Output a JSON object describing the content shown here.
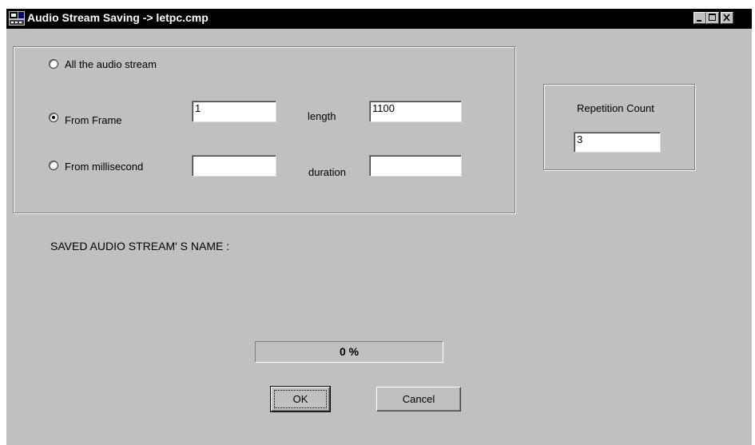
{
  "window": {
    "title": "Audio Stream Saving -> letpc.cmp",
    "controls": {
      "minimize_icon": "minimize-icon",
      "maximize_icon": "maximize-icon",
      "close_icon": "close-icon"
    }
  },
  "range_group": {
    "all_label": "All the audio stream",
    "all_checked": false,
    "frame_label": "From Frame",
    "frame_checked": true,
    "frame_value": "1",
    "length_label": "length",
    "length_value": "1100",
    "ms_label": "From millisecond",
    "ms_checked": false,
    "ms_value": "",
    "duration_label": "duration",
    "duration_value": ""
  },
  "repetition": {
    "label": "Repetition Count",
    "value": "3"
  },
  "saved_name_label": "SAVED AUDIO STREAM' S NAME :",
  "progress": {
    "text": "0 %",
    "fraction": 0
  },
  "buttons": {
    "ok": "OK",
    "cancel": "Cancel"
  }
}
